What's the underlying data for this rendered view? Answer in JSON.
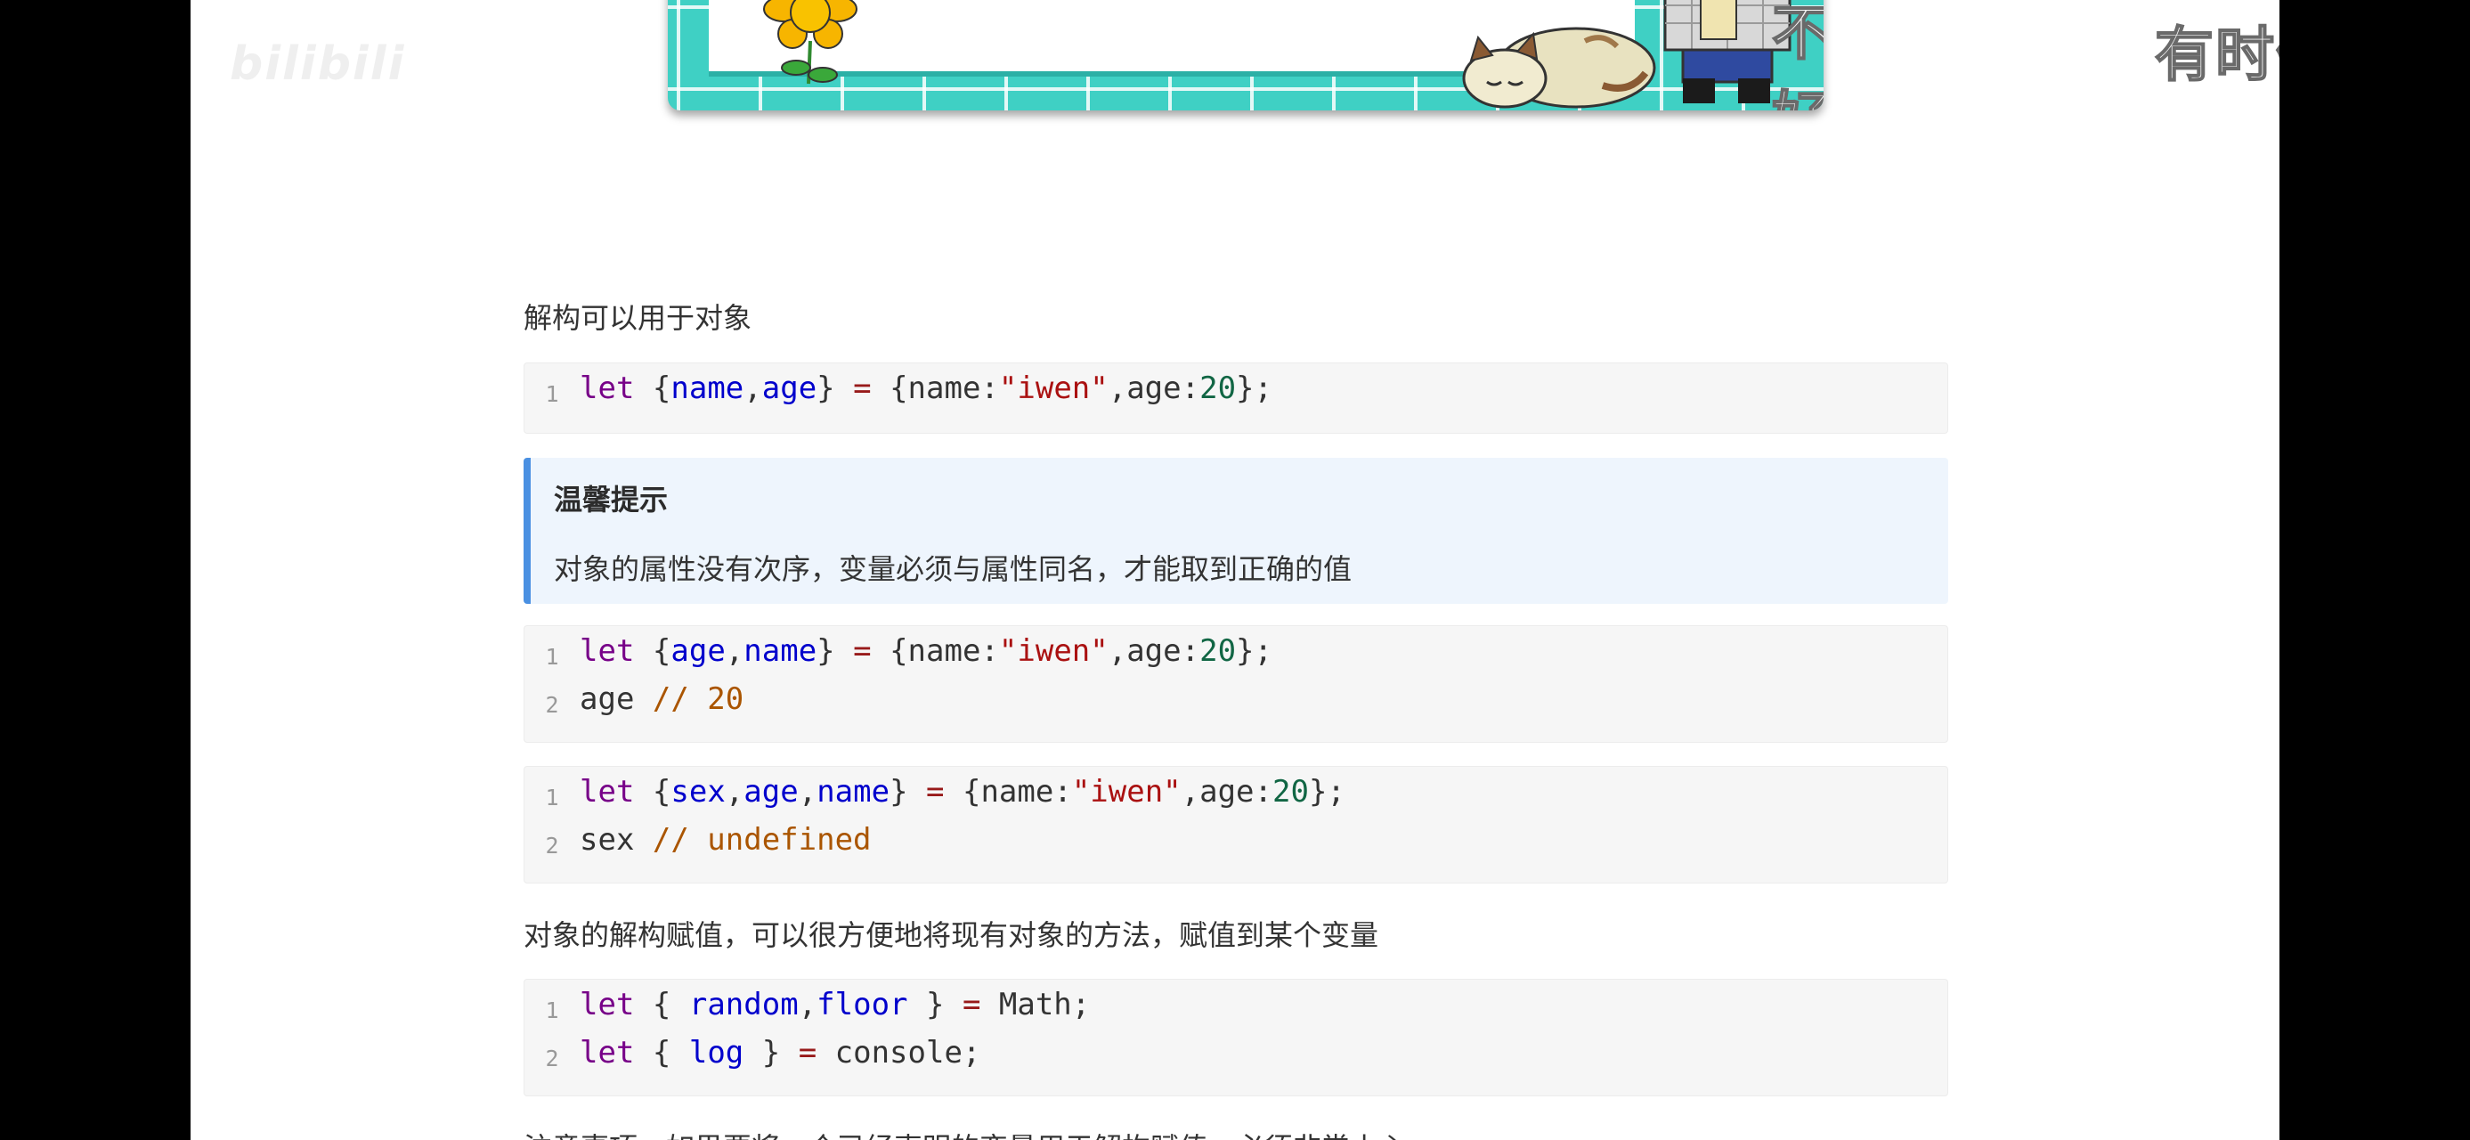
{
  "overlay": {
    "banner_caption": "不好用",
    "top_subtitle": "有时候感觉前",
    "watermark": "bilibili"
  },
  "article": {
    "para_object_destructure": "解构可以用于对象",
    "code1": {
      "lines": [
        {
          "num": "1",
          "text": "let {name,age} = {name:\"iwen\",age:20};"
        }
      ]
    },
    "tip": {
      "title": "温馨提示",
      "text": "对象的属性没有次序，变量必须与属性同名，才能取到正确的值"
    },
    "code2": {
      "lines": [
        {
          "num": "1",
          "text": "let {age,name} = {name:\"iwen\",age:20};"
        },
        {
          "num": "2",
          "text": "age // 20"
        }
      ]
    },
    "code3": {
      "lines": [
        {
          "num": "1",
          "text": "let {sex,age,name} = {name:\"iwen\",age:20};"
        },
        {
          "num": "2",
          "text": "sex // undefined"
        }
      ]
    },
    "para_method_assign": "对象的解构赋值，可以很方便地将现有对象的方法，赋值到某个变量",
    "code4": {
      "lines": [
        {
          "num": "1",
          "text": "let { random,floor } = Math;"
        },
        {
          "num": "2",
          "text": "let { log } = console;"
        }
      ]
    },
    "para_notice": "注意事项，如果要将一个已经声明的变量用于解构赋值，必须非常小心"
  },
  "colors": {
    "keyword": "#770088",
    "variable": "#0000cc",
    "operator": "#981a1a",
    "string": "#aa1111",
    "number": "#116644",
    "comment": "#aa5500",
    "tip_border": "#4a90e2",
    "tip_bg": "#eef5fd"
  }
}
